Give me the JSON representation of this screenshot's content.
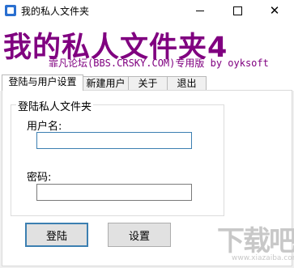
{
  "window": {
    "title": "我的私人文件夹",
    "controls": {
      "minimize": "—",
      "maximize": "☐",
      "close": "✕"
    }
  },
  "banner": {
    "title": "我的私人文件夹4",
    "subtitle": "霏凡论坛(BBS.CRSKY.COM)专用版 by oyksoft"
  },
  "tabs": [
    {
      "label": "登陆与用户设置",
      "active": true
    },
    {
      "label": "新建用户",
      "active": false
    },
    {
      "label": "关于",
      "active": false
    },
    {
      "label": "退出",
      "active": false
    }
  ],
  "login": {
    "group_title": "登陆私人文件夹",
    "username_label": "用户名:",
    "username_value": "",
    "password_label": "密码:",
    "password_value": "",
    "login_button": "登陆",
    "settings_button": "设置"
  },
  "watermark": {
    "main": "下载吧",
    "sub": "www.xiazaiba.com"
  }
}
